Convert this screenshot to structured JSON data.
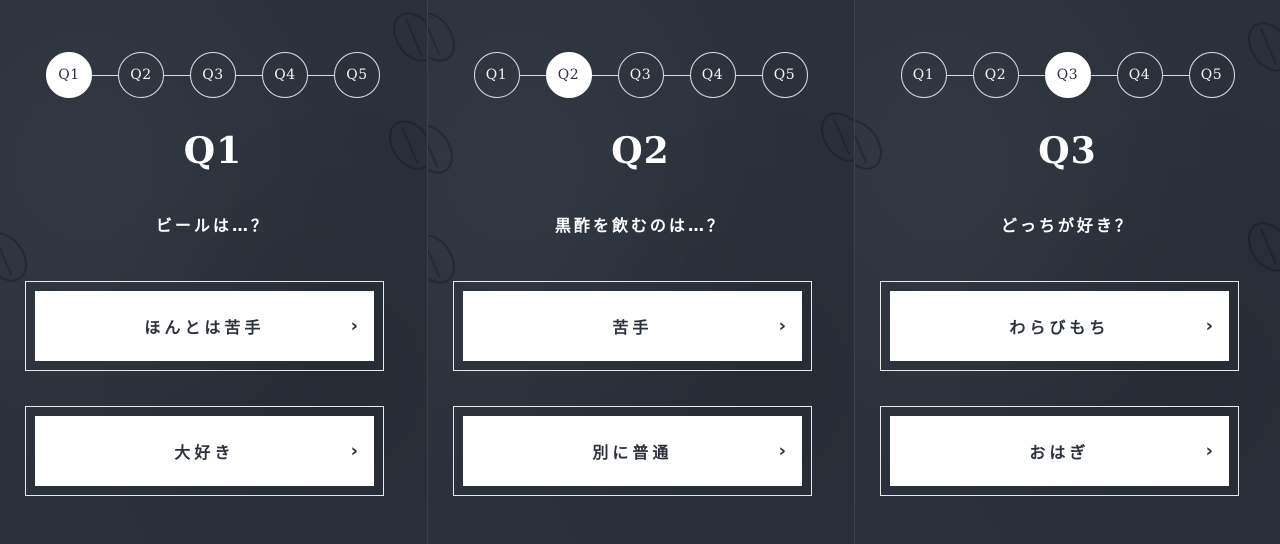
{
  "steps": [
    "Q1",
    "Q2",
    "Q3",
    "Q4",
    "Q5"
  ],
  "panels": [
    {
      "title": "Q1",
      "question": "ビールは…？",
      "answers": [
        "ほんとは苦手",
        "大好き"
      ]
    },
    {
      "title": "Q2",
      "question": "黒酢を飲むのは…？",
      "answers": [
        "苦手",
        "別に普通"
      ]
    },
    {
      "title": "Q3",
      "question": "どっちが好き？",
      "answers": [
        "わらびもち",
        "おはぎ"
      ]
    }
  ],
  "icons": {
    "chevron": "›",
    "chevron_name": "chevron-right-icon",
    "decor": "coffee-bean-icon"
  },
  "colors": {
    "background": "#2b313b",
    "card": "#ffffff",
    "accent_text": "#2b313b"
  }
}
